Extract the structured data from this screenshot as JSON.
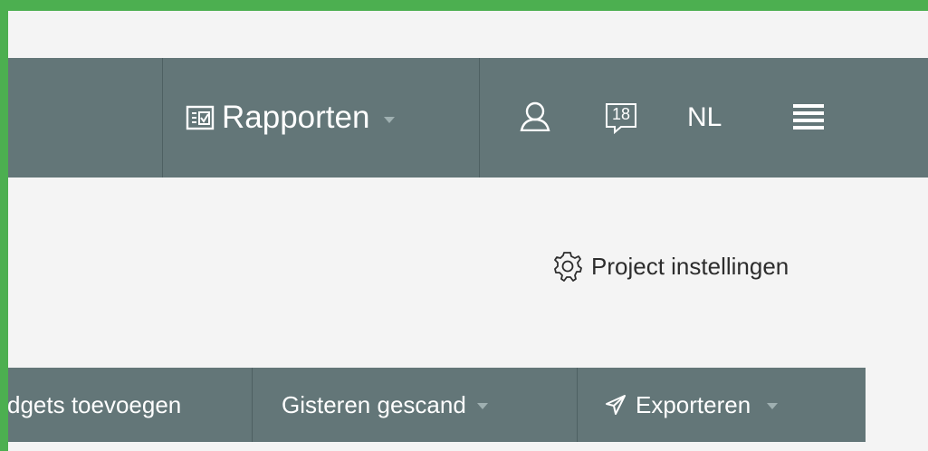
{
  "colors": {
    "frame": "#4caf50",
    "background": "#f4f4f4",
    "bar": "#637678",
    "divider": "#4e6062",
    "bar_text": "#ffffff",
    "text": "#2d2d2d"
  },
  "topnav": {
    "reports": {
      "label": "Rapporten",
      "icon": "report-icon"
    },
    "user_icon": "user-icon",
    "calendar": {
      "icon": "calendar-icon",
      "day": "18"
    },
    "language": "NL",
    "menu_icon": "hamburger-menu-icon"
  },
  "settings": {
    "label": "Project instellingen",
    "icon": "gear-icon"
  },
  "toolbar": {
    "add_widgets_label": "dgets toevoegen",
    "date_filter_label": "Gisteren gescand",
    "export_label": "Exporteren",
    "export_icon": "paper-plane-icon"
  }
}
